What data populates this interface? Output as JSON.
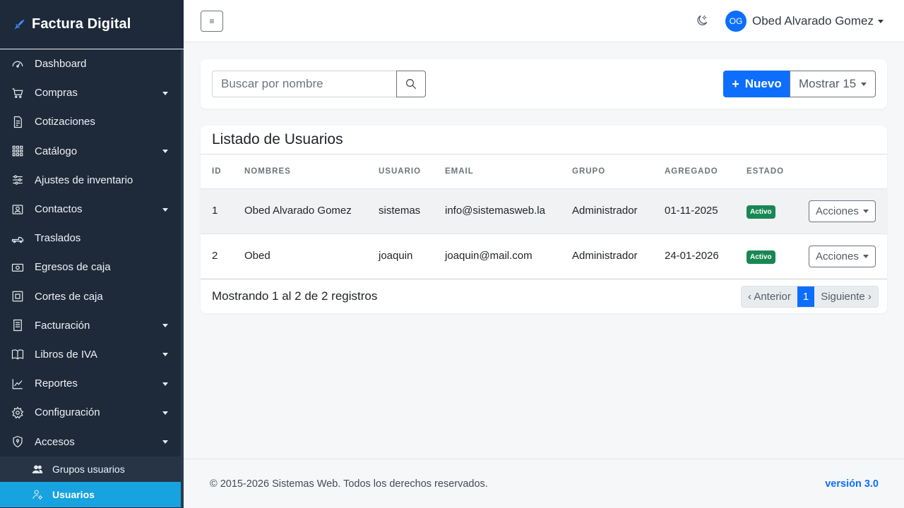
{
  "brand": {
    "name": "Factura Digital"
  },
  "sidebar": {
    "items": [
      {
        "label": "Dashboard",
        "icon": "dashboard-icon",
        "has_submenu": false
      },
      {
        "label": "Compras",
        "icon": "cart-icon",
        "has_submenu": true
      },
      {
        "label": "Cotizaciones",
        "icon": "document-icon",
        "has_submenu": false
      },
      {
        "label": "Catálogo",
        "icon": "grid-icon",
        "has_submenu": true
      },
      {
        "label": "Ajustes de inventario",
        "icon": "sliders-icon",
        "has_submenu": false
      },
      {
        "label": "Contactos",
        "icon": "contact-icon",
        "has_submenu": true
      },
      {
        "label": "Traslados",
        "icon": "truck-icon",
        "has_submenu": false
      },
      {
        "label": "Egresos de caja",
        "icon": "cash-icon",
        "has_submenu": false
      },
      {
        "label": "Cortes de caja",
        "icon": "register-icon",
        "has_submenu": false
      },
      {
        "label": "Facturación",
        "icon": "receipt-icon",
        "has_submenu": true
      },
      {
        "label": "Libros de IVA",
        "icon": "book-icon",
        "has_submenu": true
      },
      {
        "label": "Reportes",
        "icon": "chart-icon",
        "has_submenu": true
      },
      {
        "label": "Configuración",
        "icon": "gear-icon",
        "has_submenu": true
      },
      {
        "label": "Accesos",
        "icon": "shield-icon",
        "has_submenu": true
      }
    ],
    "subitems": [
      {
        "label": "Grupos usuarios",
        "icon": "users-icon",
        "active": false
      },
      {
        "label": "Usuarios",
        "icon": "user-gear-icon",
        "active": true
      }
    ]
  },
  "topbar": {
    "toggle_label": "≡",
    "user": {
      "initials": "OG",
      "name": "Obed Alvarado Gomez"
    }
  },
  "toolbar": {
    "search_placeholder": "Buscar por nombre",
    "new_label": "Nuevo",
    "new_plus": "+",
    "show_label": "Mostrar 15"
  },
  "table": {
    "title": "Listado de Usuarios",
    "columns": [
      "ID",
      "NOMBRES",
      "USUARIO",
      "EMAIL",
      "GRUPO",
      "AGREGADO",
      "ESTADO"
    ],
    "rows": [
      {
        "id": "1",
        "nombres": "Obed Alvarado Gomez",
        "usuario": "sistemas",
        "email": "info@sistemasweb.la",
        "grupo": "Administrador",
        "agregado": "01-11-2025",
        "estado": "Activo",
        "acciones": "Acciones"
      },
      {
        "id": "2",
        "nombres": "Obed",
        "usuario": "joaquin",
        "email": "joaquin@mail.com",
        "grupo": "Administrador",
        "agregado": "24-01-2026",
        "estado": "Activo",
        "acciones": "Acciones"
      }
    ],
    "footer_text": "Mostrando 1 al 2 de 2 registros",
    "pagination": {
      "prev": "‹ Anterior",
      "current": "1",
      "next": "Siguiente ›"
    }
  },
  "footer": {
    "copyright": "© 2015-2026 Sistemas Web. Todos los derechos reservados.",
    "version": "versión 3.0"
  },
  "colors": {
    "sidebar_bg": "#1e2a3a",
    "accent": "#0d6efd",
    "active_item": "#17a2e0",
    "badge_success": "#198754"
  }
}
